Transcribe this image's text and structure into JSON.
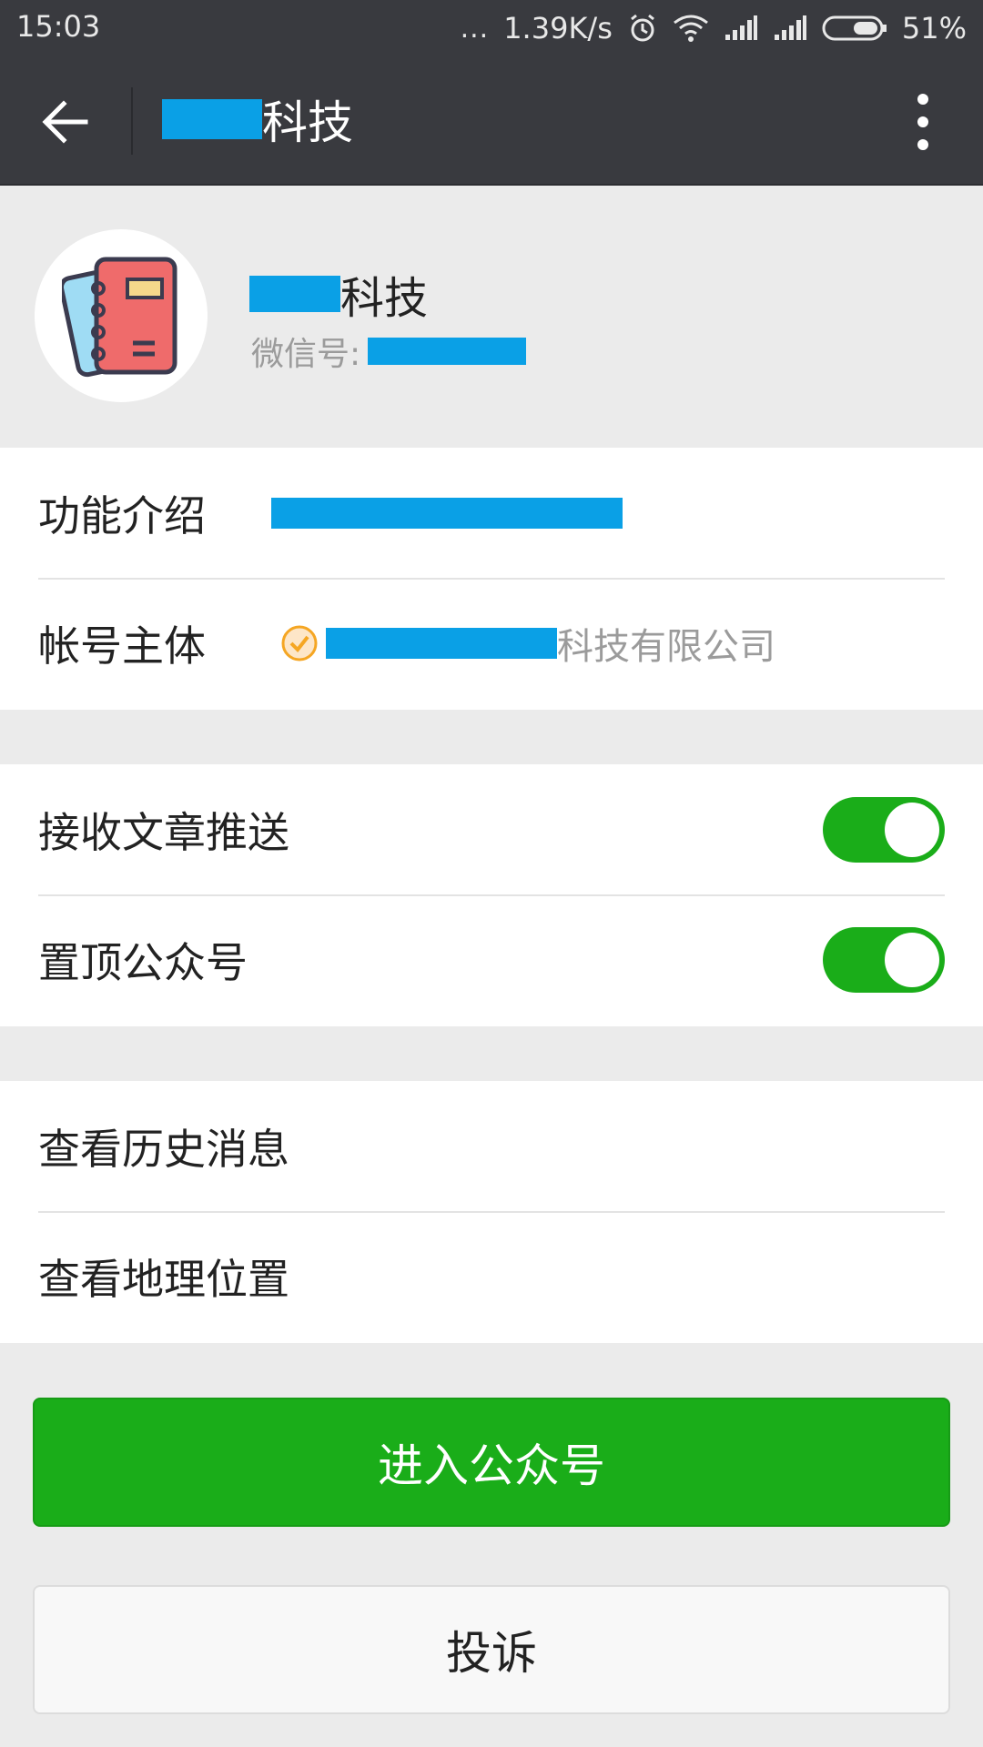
{
  "status_bar": {
    "time": "15:03",
    "dots": "...",
    "net_speed": "1.39K/s",
    "battery_percent": "51%",
    "icons": [
      "alarm-icon",
      "wifi-icon",
      "signal-icon",
      "signal-icon",
      "battery-icon"
    ]
  },
  "header": {
    "title_suffix": "科技",
    "back_icon": "arrow-left-icon",
    "more_icon": "more-vertical-icon"
  },
  "profile": {
    "avatar_icon": "notebook-icon",
    "name_suffix": "科技",
    "wechat_id_label": "微信号:"
  },
  "info": {
    "intro_label": "功能介绍",
    "entity_label": "帐号主体",
    "entity_value_suffix": "科技有限公司",
    "entity_verified_icon": "verified-check-icon"
  },
  "settings": {
    "receive_push_label": "接收文章推送",
    "receive_push_on": true,
    "pin_top_label": "置顶公众号",
    "pin_top_on": true
  },
  "links": {
    "history_label": "查看历史消息",
    "location_label": "查看地理位置"
  },
  "actions": {
    "enter_label": "进入公众号",
    "complain_label": "投诉"
  },
  "colors": {
    "header_bg": "#393a3f",
    "accent_green": "#1aad19",
    "redaction": "#0aa0e6",
    "page_bg": "#ebebeb"
  }
}
